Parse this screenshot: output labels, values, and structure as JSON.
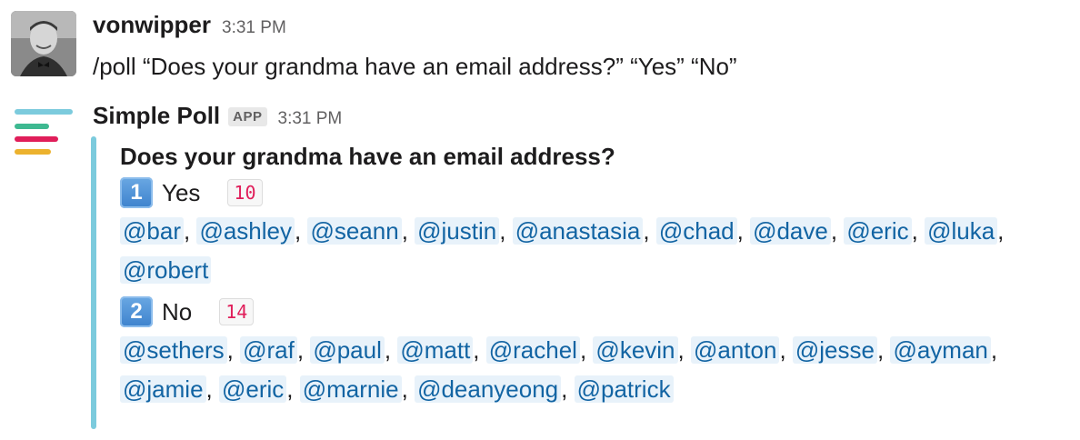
{
  "messages": {
    "user": {
      "username": "vonwipper",
      "time": "3:31 PM",
      "text": "/poll “Does your grandma have an email address?” “Yes” “No”",
      "avatar": "user-avatar"
    },
    "bot": {
      "name": "Simple Poll",
      "badge": "APP",
      "time": "3:31 PM",
      "icon": "simple-poll-logo",
      "accent_color": "#7ccbdd",
      "poll": {
        "question": "Does your grandma have an email address?",
        "options": [
          {
            "number": "1",
            "label": "Yes",
            "count": "10",
            "voters": [
              "@bar",
              "@ashley",
              "@seann",
              "@justin",
              "@anastasia",
              "@chad",
              "@dave",
              "@eric",
              "@luka",
              "@robert"
            ]
          },
          {
            "number": "2",
            "label": "No",
            "count": "14",
            "voters": [
              "@sethers",
              "@raf",
              "@paul",
              "@matt",
              "@rachel",
              "@kevin",
              "@anton",
              "@jesse",
              "@ayman",
              "@jamie",
              "@eric",
              "@marnie",
              "@deanyeong",
              "@patrick"
            ]
          }
        ]
      }
    }
  },
  "colors": {
    "mention_text": "#1264a3",
    "mention_bg": "#e8f2fa",
    "count_text": "#e01e5a",
    "logo_teal": "#7ccbdd",
    "logo_green": "#3eb991",
    "logo_pink": "#e01e5a",
    "logo_yellow": "#ecb22e"
  }
}
